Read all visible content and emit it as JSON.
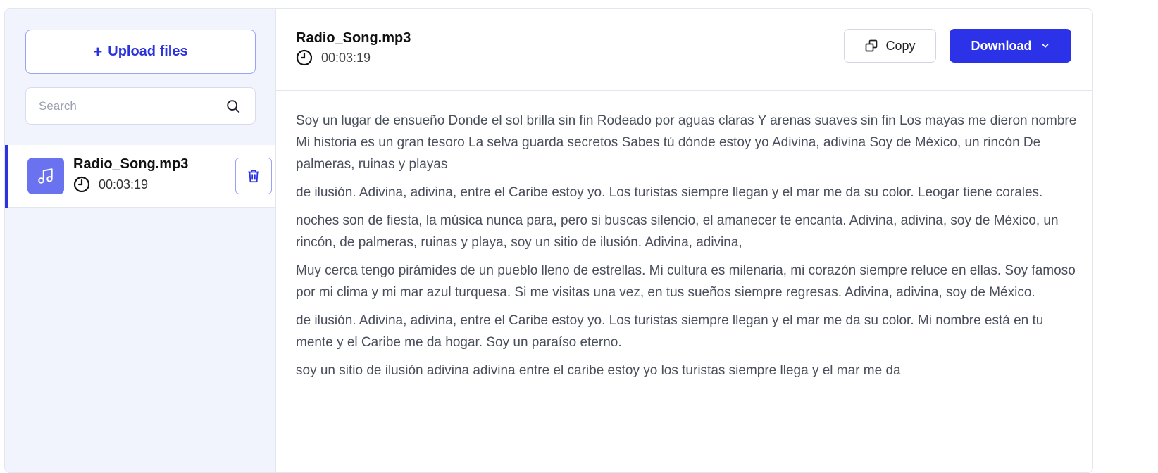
{
  "sidebar": {
    "upload_label": "Upload files",
    "upload_plus": "+",
    "search_placeholder": "Search",
    "files": [
      {
        "name": "Radio_Song.mp3",
        "duration": "00:03:19"
      }
    ]
  },
  "main": {
    "title": "Radio_Song.mp3",
    "duration": "00:03:19",
    "copy_label": "Copy",
    "download_label": "Download",
    "paragraphs": [
      "Soy un lugar de ensueño Donde el sol brilla sin fin Rodeado por aguas claras Y arenas suaves sin fin Los mayas me dieron nombre Mi historia es un gran tesoro La selva guarda secretos Sabes tú dónde estoy yo Adivina, adivina Soy de México, un rincón De palmeras, ruinas y playas",
      "de ilusión. Adivina, adivina, entre el Caribe estoy yo. Los turistas siempre llegan y el mar me da su color. Leogar tiene corales.",
      "noches son de fiesta, la música nunca para, pero si buscas silencio, el amanecer te encanta. Adivina, adivina, soy de México, un rincón, de palmeras, ruinas y playa, soy un sitio de ilusión. Adivina, adivina,",
      "Muy cerca tengo pirámides de un pueblo lleno de estrellas. Mi cultura es milenaria, mi corazón siempre reluce en ellas. Soy famoso por mi clima y mi mar azul turquesa. Si me visitas una vez, en tus sueños siempre regresas. Adivina, adivina, soy de México.",
      "de ilusión. Adivina, adivina, entre el Caribe estoy yo. Los turistas siempre llegan y el mar me da su color. Mi nombre está en tu mente y el Caribe me da hogar. Soy un paraíso eterno.",
      "soy un sitio de ilusión adivina adivina entre el caribe estoy yo los turistas siempre llega y el mar me da"
    ]
  },
  "colors": {
    "accent": "#2b32e8",
    "sidebar_bg": "#f2f4fd",
    "music_tile": "#6a72f0"
  }
}
